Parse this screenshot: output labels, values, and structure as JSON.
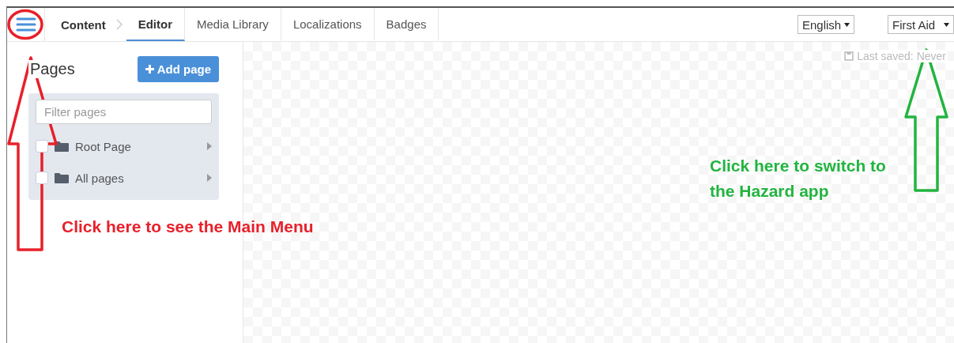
{
  "navbar": {
    "breadcrumb": "Content",
    "tabs": [
      {
        "label": "Editor",
        "selected": true
      },
      {
        "label": "Media Library",
        "selected": false
      },
      {
        "label": "Localizations",
        "selected": false
      },
      {
        "label": "Badges",
        "selected": false
      }
    ],
    "language": "English",
    "app": "First Aid"
  },
  "sidebar": {
    "title": "Pages",
    "add_button": "Add page",
    "filter": {
      "placeholder": "Filter pages"
    },
    "items": [
      {
        "label": "Root Page",
        "checked": false
      },
      {
        "label": "All pages",
        "checked": false
      }
    ]
  },
  "status": "Last saved: Never",
  "annotations": [
    {
      "kind": "circle",
      "color": "#e8202a"
    },
    {
      "kind": "arrow",
      "color": "#e8202a"
    },
    {
      "kind": "note",
      "color": "#e8202a",
      "lines": [
        "Click here to see the Main Menu"
      ]
    },
    {
      "kind": "arrow",
      "color": "#22b440"
    },
    {
      "kind": "note",
      "color": "#22b440",
      "lines": [
        "Click here to switch to",
        "the Hazard app"
      ]
    }
  ]
}
